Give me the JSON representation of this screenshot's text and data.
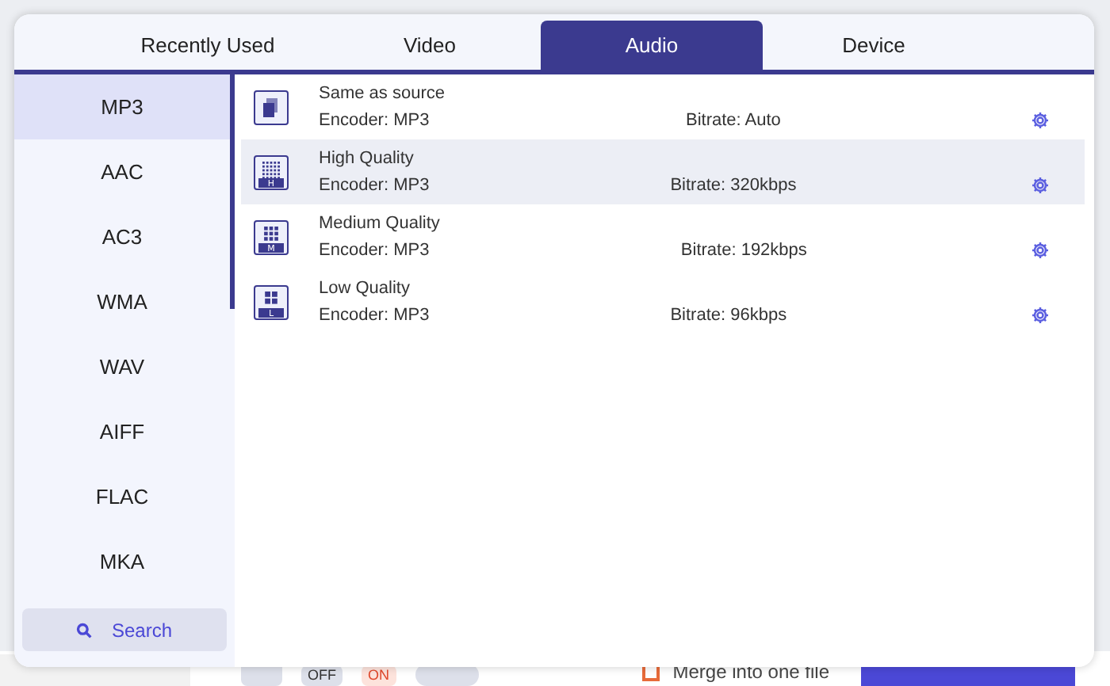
{
  "background": {
    "toggles": [
      {
        "label": "OFF",
        "kind": "off"
      },
      {
        "label": "ON",
        "kind": "on"
      }
    ],
    "merge_checked": false,
    "merge_label": "Merge into one file"
  },
  "tabs": [
    {
      "label": "Recently Used",
      "selected": false
    },
    {
      "label": "Video",
      "selected": false
    },
    {
      "label": "Audio",
      "selected": true
    },
    {
      "label": "Device",
      "selected": false
    }
  ],
  "formats": [
    {
      "label": "MP3",
      "selected": true
    },
    {
      "label": "AAC",
      "selected": false
    },
    {
      "label": "AC3",
      "selected": false
    },
    {
      "label": "WMA",
      "selected": false
    },
    {
      "label": "WAV",
      "selected": false
    },
    {
      "label": "AIFF",
      "selected": false
    },
    {
      "label": "FLAC",
      "selected": false
    },
    {
      "label": "MKA",
      "selected": false
    }
  ],
  "search_button": "Search",
  "presets": [
    {
      "kind": "source",
      "name": "Same as source",
      "encoder": "Encoder: MP3",
      "bitrate": "Bitrate: Auto",
      "selected": false
    },
    {
      "kind": "high",
      "badge": "H",
      "name": "High Quality",
      "encoder": "Encoder: MP3",
      "bitrate": "Bitrate: 320kbps",
      "selected": true
    },
    {
      "kind": "medium",
      "badge": "M",
      "name": "Medium Quality",
      "encoder": "Encoder: MP3",
      "bitrate": "Bitrate: 192kbps",
      "selected": false
    },
    {
      "kind": "low",
      "badge": "L",
      "name": "Low Quality",
      "encoder": "Encoder: MP3",
      "bitrate": "Bitrate: 96kbps",
      "selected": false
    }
  ]
}
